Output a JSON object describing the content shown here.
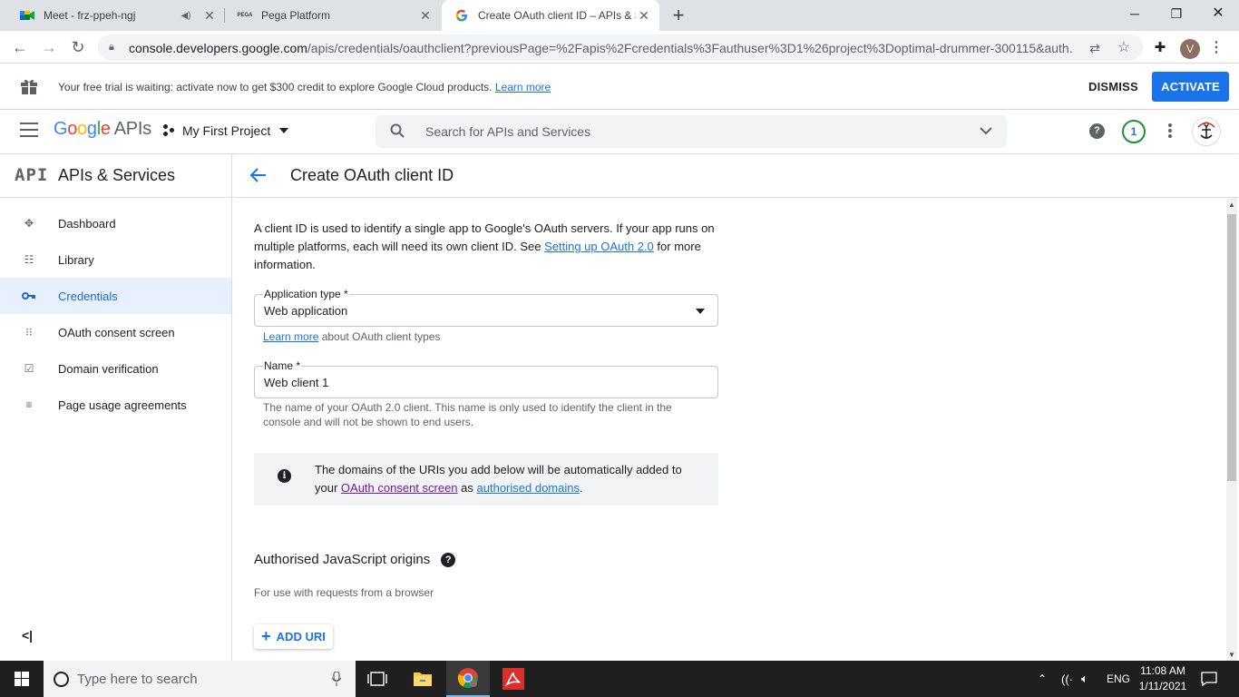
{
  "browser": {
    "tabs": [
      {
        "title": "Meet - frz-ppeh-ngj",
        "favicon": "meet-icon"
      },
      {
        "title": "Pega Platform",
        "favicon": "pega-icon",
        "favicon_text": "PEGA"
      },
      {
        "title": "Create OAuth client ID – APIs & S",
        "favicon": "google-icon"
      }
    ],
    "url_host": "console.developers.google.com",
    "url_path": "/apis/credentials/oauthclient?previousPage=%2Fapis%2Fcredentials%3Fauthuser%3D1%26project%3Doptimal-drummer-300115&auth...",
    "profile_initial": "V"
  },
  "banner": {
    "message": "Your free trial is waiting: activate now to get $300 credit to explore Google Cloud products.",
    "learn_more": "Learn more",
    "dismiss": "DISMISS",
    "activate": "ACTIVATE"
  },
  "header": {
    "logo_google": "Google",
    "logo_apis": "APIs",
    "project": "My First Project",
    "search_placeholder": "Search for APIs and Services",
    "notification_count": "1"
  },
  "sidebar": {
    "logo": "API",
    "title": "APIs & Services",
    "items": [
      {
        "label": "Dashboard",
        "icon": "dashboard-icon"
      },
      {
        "label": "Library",
        "icon": "library-icon"
      },
      {
        "label": "Credentials",
        "icon": "key-icon",
        "active": true
      },
      {
        "label": "OAuth consent screen",
        "icon": "consent-icon"
      },
      {
        "label": "Domain verification",
        "icon": "checkbox-icon"
      },
      {
        "label": "Page usage agreements",
        "icon": "settings-list-icon"
      }
    ],
    "collapse": "<|"
  },
  "main": {
    "title": "Create OAuth client ID",
    "intro_1": "A client ID is used to identify a single app to Google's OAuth servers. If your app runs on multiple platforms, each will need its own client ID. See ",
    "intro_link": "Setting up OAuth 2.0",
    "intro_2": " for more information.",
    "app_type_label": "Application type *",
    "app_type_value": "Web application",
    "learn_more": "Learn more",
    "learn_more_suffix": " about OAuth client types",
    "name_label": "Name *",
    "name_value": "Web client 1",
    "name_hint": "The name of your OAuth 2.0 client. This name is only used to identify the client in the console and will not be shown to end users.",
    "info_1": "The domains of the URIs you add below will be automatically added to your ",
    "info_link1": "OAuth consent screen",
    "info_mid": " as ",
    "info_link2": "authorised domains",
    "info_end": ".",
    "origins_title": "Authorised JavaScript origins",
    "origins_sub": "For use with requests from a browser",
    "add_uri": "ADD URI"
  },
  "taskbar": {
    "search_placeholder": "Type here to search",
    "language": "ENG",
    "time": "11:08 AM",
    "date": "1/11/2021"
  },
  "colors": {
    "accent": "#1a73e8",
    "active_nav_bg": "#e8f0fe",
    "visited_link": "#681da8"
  }
}
